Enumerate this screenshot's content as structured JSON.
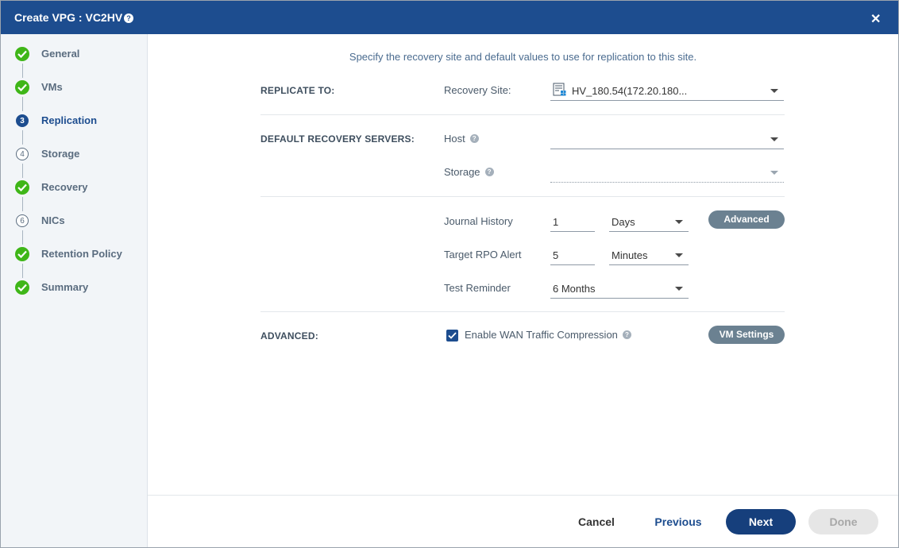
{
  "dialog": {
    "title": "Create VPG : VC2HV"
  },
  "steps": [
    {
      "label": "General",
      "status": "done"
    },
    {
      "label": "VMs",
      "status": "done"
    },
    {
      "label": "Replication",
      "status": "active",
      "number": "3"
    },
    {
      "label": "Storage",
      "status": "pending",
      "number": "4"
    },
    {
      "label": "Recovery",
      "status": "done"
    },
    {
      "label": "NICs",
      "status": "pending",
      "number": "6"
    },
    {
      "label": "Retention Policy",
      "status": "done"
    },
    {
      "label": "Summary",
      "status": "done"
    }
  ],
  "intro": "Specify the recovery site and default values to use for replication to this site.",
  "replicate_to": {
    "section_label": "REPLICATE TO:",
    "recovery_site_label": "Recovery Site:",
    "recovery_site_value": "HV_180.54(172.20.180..."
  },
  "default_recovery_servers": {
    "section_label": "DEFAULT RECOVERY SERVERS:",
    "host_label": "Host",
    "host_value": "",
    "storage_label": "Storage",
    "storage_value": ""
  },
  "history": {
    "journal_label": "Journal History",
    "journal_value": "1",
    "journal_unit": "Days",
    "rpo_label": "Target RPO Alert",
    "rpo_value": "5",
    "rpo_unit": "Minutes",
    "test_label": "Test Reminder",
    "test_value": "6 Months",
    "advanced_button": "Advanced"
  },
  "advanced": {
    "section_label": "ADVANCED:",
    "wan_label": "Enable WAN Traffic Compression",
    "wan_checked": true,
    "vm_settings_button": "VM Settings"
  },
  "footer": {
    "cancel": "Cancel",
    "previous": "Previous",
    "next": "Next",
    "done": "Done"
  },
  "colors": {
    "header": "#1d4d8f",
    "check": "#3fb618",
    "pill": "#6b8191",
    "next": "#163f7c"
  }
}
